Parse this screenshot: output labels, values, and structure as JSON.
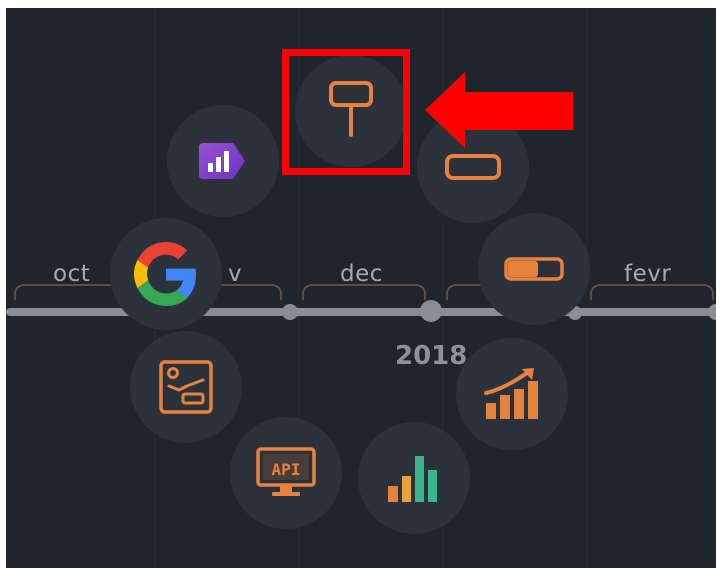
{
  "timeline": {
    "months": [
      {
        "label": "oct"
      },
      {
        "label": "v"
      },
      {
        "label": "dec"
      },
      {
        "label": "fevr"
      }
    ],
    "year": "2018"
  },
  "radial_menu": {
    "items": [
      {
        "icon": "sign-post-icon",
        "state": "highlighted"
      },
      {
        "icon": "bar-chart-badge-icon"
      },
      {
        "icon": "rectangle-shape-icon"
      },
      {
        "icon": "google-logo-icon"
      },
      {
        "icon": "toggle-switch-icon"
      },
      {
        "icon": "chart-rule-icon"
      },
      {
        "icon": "growth-chart-icon"
      },
      {
        "icon": "api-monitor-icon",
        "text": "API"
      },
      {
        "icon": "bar-chart-icon"
      }
    ]
  },
  "annotation": {
    "highlight_color": "#ff0000",
    "arrow_color": "#ff0000"
  },
  "colors": {
    "background": "#1f252d",
    "button": "#2b323b",
    "accent": "#e8823f",
    "axis": "#8a8d91"
  }
}
